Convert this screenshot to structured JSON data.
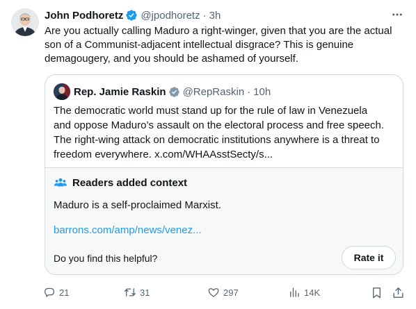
{
  "tweet": {
    "author_name": "John Podhoretz",
    "handle": "@jpodhoretz",
    "separator": "·",
    "time": "3h",
    "text": "Are you actually calling Maduro a right-winger, given that you are the actual\nson of a Communist-adjacent intellectual disgrace? This is genuine\ndemagougery, and you should be ashamed of yourself.",
    "avatar_icon": "avatar-photo",
    "more_icon": "more-options-icon"
  },
  "quoted": {
    "author_name": "Rep. Jamie Raskin",
    "handle": "@RepRaskin",
    "separator": "·",
    "time": "10h",
    "text": "The democratic world must stand up for the rule of law in Venezuela\nand oppose Maduro’s assault on the electoral process and free speech.\nThe right-wing attack on democratic institutions anywhere is a threat to\nfreedom everywhere. x.com/WHAAsstSecty/s..."
  },
  "community_note": {
    "title": "Readers added context",
    "note": "Maduro is a self-proclaimed Marxist.",
    "link": "barrons.com/amp/news/venez...",
    "question": "Do you find this helpful?",
    "rate_label": "Rate it"
  },
  "actions": {
    "replies": "21",
    "reposts": "31",
    "likes": "297",
    "views": "14K"
  },
  "colors": {
    "accent": "#1d9bf0",
    "muted": "#536471",
    "border": "#cfd9de",
    "verified_blue": "#1d9bf0",
    "verified_gray": "#829aab"
  }
}
